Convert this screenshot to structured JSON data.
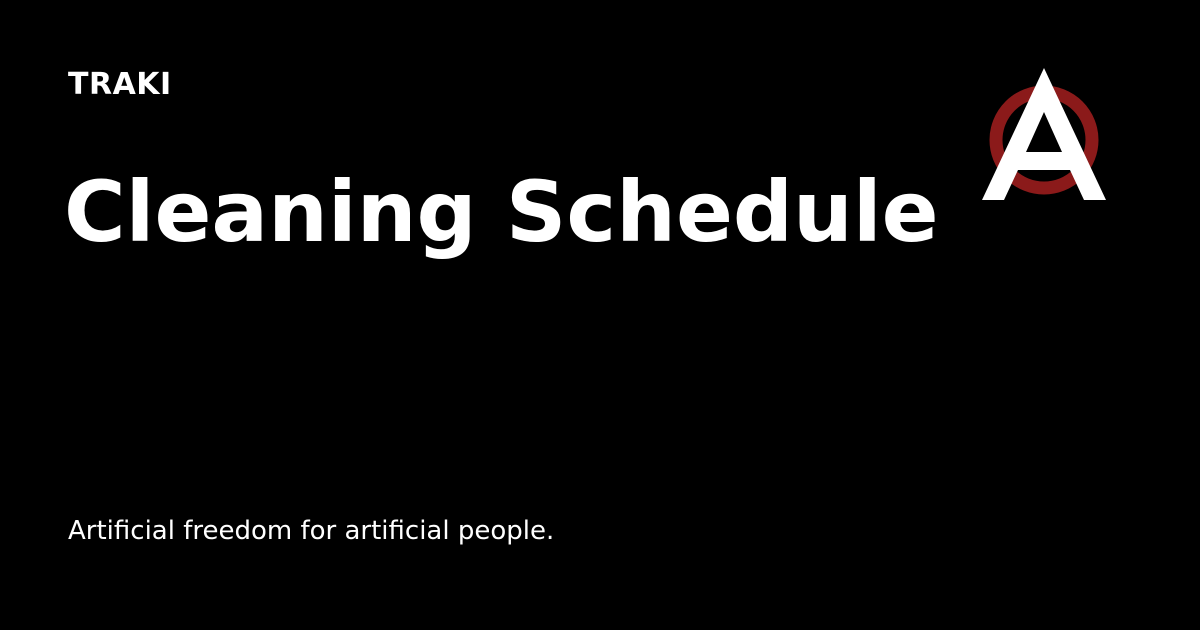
{
  "site": {
    "name": "TRAKI"
  },
  "page": {
    "title": "Cleaning Schedule",
    "tagline": "Artificial freedom for artificial people."
  },
  "logo": {
    "icon": "circle-a-logo-icon",
    "ring_color": "#8b1a1a",
    "letter_color": "#ffffff"
  },
  "colors": {
    "background": "#000000",
    "text": "#ffffff"
  }
}
